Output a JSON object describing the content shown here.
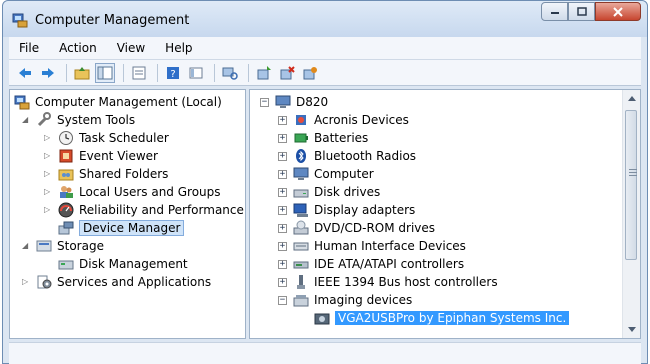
{
  "window": {
    "title": "Computer Management"
  },
  "menubar": {
    "items": [
      "File",
      "Action",
      "View",
      "Help"
    ]
  },
  "toolbar": {
    "buttons": [
      "back-arrow-icon",
      "forward-arrow-icon",
      "up-folder-icon",
      "show-hide-tree-icon",
      "properties-icon",
      "help-icon",
      "view-icon",
      "scan-hardware-icon",
      "update-driver-icon",
      "uninstall-icon",
      "disable-icon"
    ]
  },
  "left_tree": {
    "root": "Computer Management (Local)",
    "system_tools": "System Tools",
    "task_scheduler": "Task Scheduler",
    "event_viewer": "Event Viewer",
    "shared_folders": "Shared Folders",
    "local_users_groups": "Local Users and Groups",
    "reliability_performance": "Reliability and Performance",
    "device_manager": "Device Manager",
    "storage": "Storage",
    "disk_management": "Disk Management",
    "services_applications": "Services and Applications"
  },
  "device_tree": {
    "root": "D820",
    "categories": [
      "Acronis Devices",
      "Batteries",
      "Bluetooth Radios",
      "Computer",
      "Disk drives",
      "Display adapters",
      "DVD/CD-ROM drives",
      "Human Interface Devices",
      "IDE ATA/ATAPI controllers",
      "IEEE 1394 Bus host controllers",
      "Imaging devices"
    ],
    "selected_device": "VGA2USBPro by Epiphan Systems Inc."
  }
}
